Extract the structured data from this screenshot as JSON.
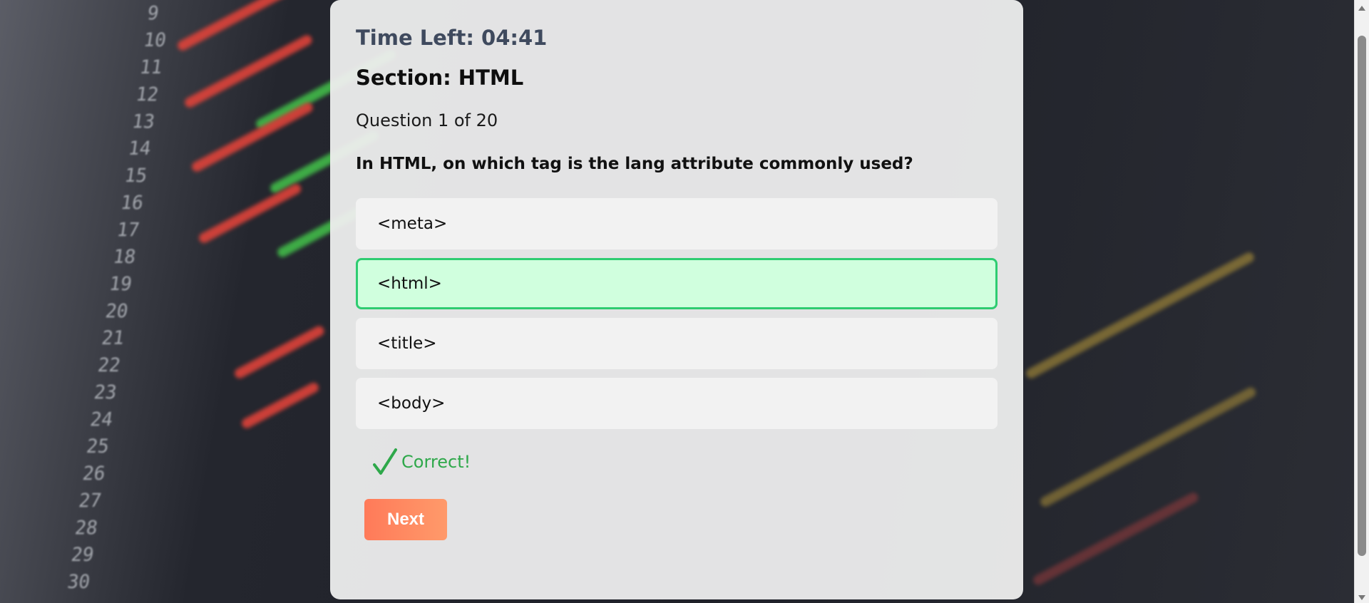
{
  "quiz": {
    "timer": "Time Left: 04:41",
    "section": "Section: HTML",
    "progress": "Question 1 of 20",
    "question": "In HTML, on which tag is the lang attribute commonly used?",
    "options": [
      {
        "label": "<meta>",
        "state": "default"
      },
      {
        "label": "<html>",
        "state": "correct"
      },
      {
        "label": "<title>",
        "state": "default"
      },
      {
        "label": "<body>",
        "state": "default"
      }
    ],
    "feedback": "Correct!",
    "next_label": "Next"
  },
  "background": {
    "line_numbers": [
      "9",
      "10",
      "11",
      "12",
      "13",
      "14",
      "15",
      "16",
      "17",
      "18",
      "19",
      "20",
      "21",
      "22",
      "23",
      "24",
      "25",
      "26",
      "27",
      "28",
      "29",
      "30"
    ]
  },
  "colors": {
    "correct_fill": "#d0ffde",
    "correct_border": "#2ecc71",
    "feedback_text": "#2ea84a",
    "button_gradient_start": "#ff7a59",
    "button_gradient_end": "#ff9a6a",
    "timer_text": "#3f4a5e"
  }
}
